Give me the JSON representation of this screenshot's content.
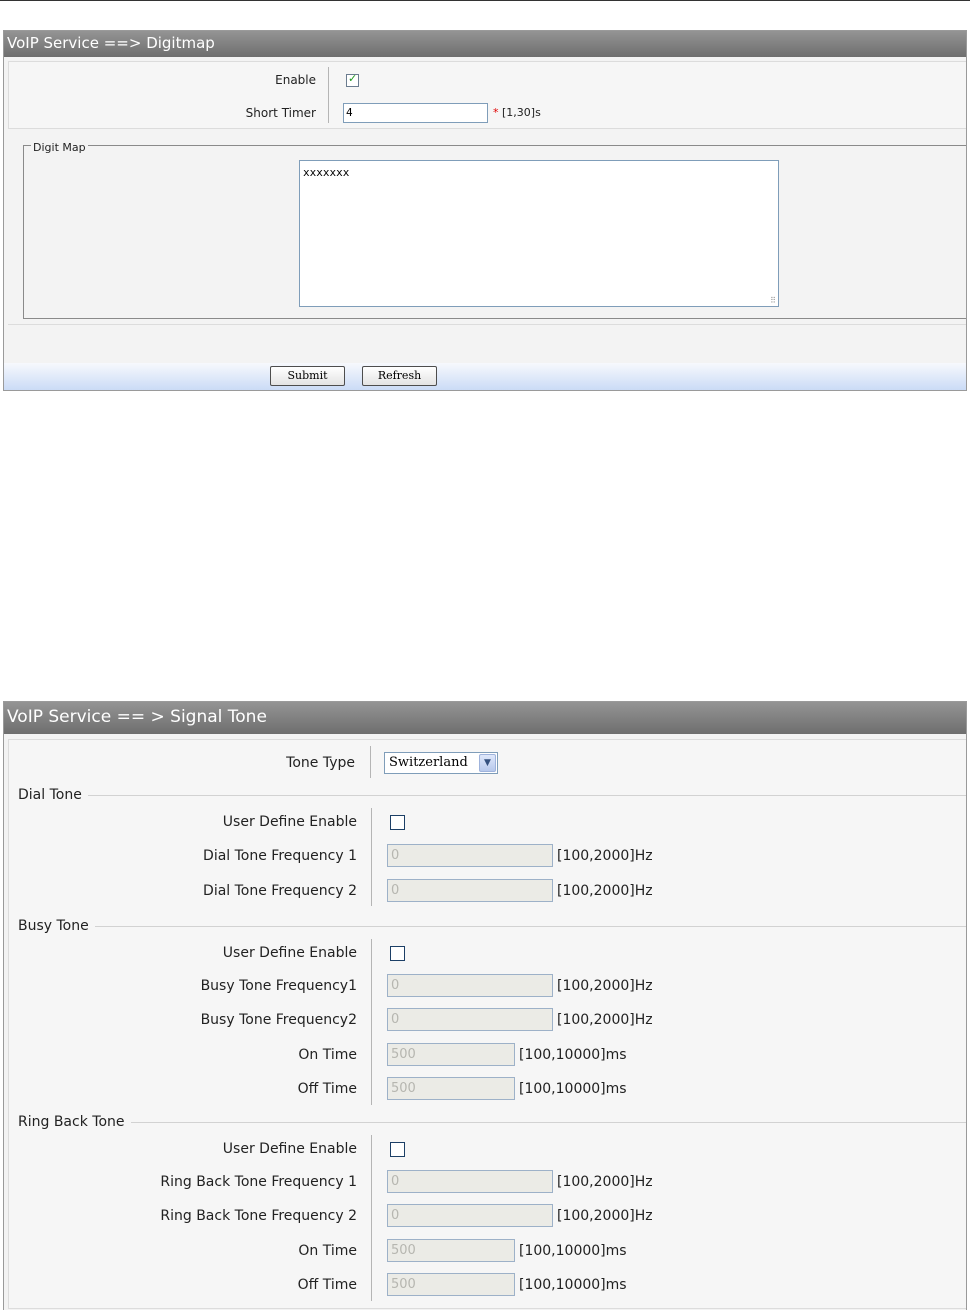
{
  "digitmap": {
    "title": "VoIP Service ==> Digitmap",
    "enable_label": "Enable",
    "enable_checked": true,
    "short_timer_label": "Short Timer",
    "short_timer_value": "4",
    "short_timer_required": "*",
    "short_timer_range": "[1,30]s",
    "digit_map_legend": "Digit Map",
    "digit_map_value": "xxxxxxx",
    "submit_label": "Submit",
    "refresh_label": "Refresh"
  },
  "signal_tone": {
    "title": "VoIP Service == > Signal Tone",
    "tone_type_label": "Tone Type",
    "tone_type_value": "Switzerland",
    "dial_tone": {
      "section": "Dial Tone",
      "user_define_label": "User Define Enable",
      "user_define_checked": false,
      "freq1_label": "Dial Tone Frequency 1",
      "freq1_value": "0",
      "freq1_range": "[100,2000]Hz",
      "freq2_label": "Dial Tone Frequency 2",
      "freq2_value": "0",
      "freq2_range": "[100,2000]Hz"
    },
    "busy_tone": {
      "section": "Busy Tone",
      "user_define_label": "User Define Enable",
      "user_define_checked": false,
      "freq1_label": "Busy Tone Frequency1",
      "freq1_value": "0",
      "freq1_range": "[100,2000]Hz",
      "freq2_label": "Busy Tone Frequency2",
      "freq2_value": "0",
      "freq2_range": "[100,2000]Hz",
      "on_time_label": "On Time",
      "on_time_value": "500",
      "on_time_range": "[100,10000]ms",
      "off_time_label": "Off Time",
      "off_time_value": "500",
      "off_time_range": "[100,10000]ms"
    },
    "ring_back_tone": {
      "section": "Ring Back Tone",
      "user_define_label": "User Define Enable",
      "user_define_checked": false,
      "freq1_label": "Ring Back Tone Frequency 1",
      "freq1_value": "0",
      "freq1_range": "[100,2000]Hz",
      "freq2_label": "Ring Back Tone Frequency 2",
      "freq2_value": "0",
      "freq2_range": "[100,2000]Hz",
      "on_time_label": "On Time",
      "on_time_value": "500",
      "on_time_range": "[100,10000]ms",
      "off_time_label": "Off Time",
      "off_time_value": "500",
      "off_time_range": "[100,10000]ms"
    }
  }
}
